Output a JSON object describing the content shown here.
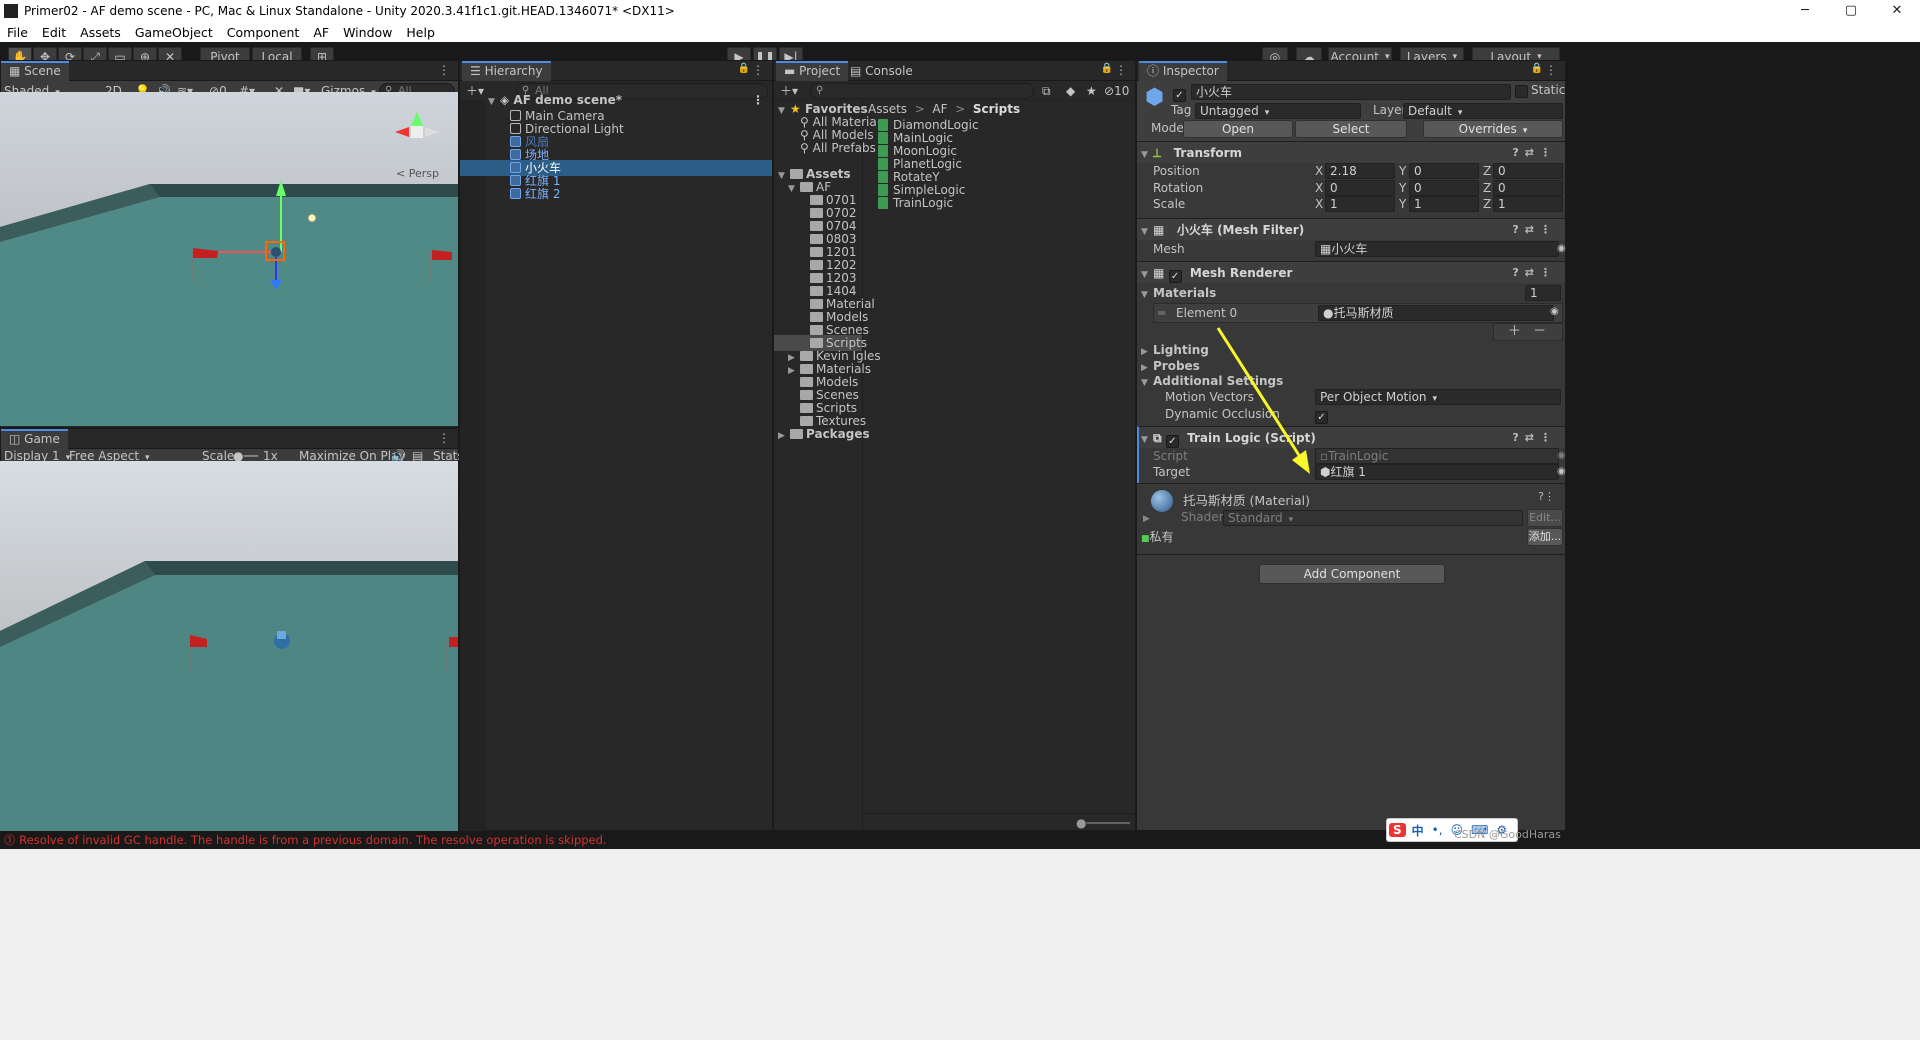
{
  "window": {
    "title": "Primer02 - AF demo scene - PC, Mac & Linux Standalone - Unity 2020.3.41f1c1.git.HEAD.1346071* <DX11>",
    "controls": [
      "─",
      "▢",
      "✕"
    ]
  },
  "menu": [
    "File",
    "Edit",
    "Assets",
    "GameObject",
    "Component",
    "AF",
    "Window",
    "Help"
  ],
  "toolbar": {
    "pivot": "Pivot",
    "local": "Local",
    "account": "Account",
    "layers": "Layers",
    "layout": "Layout"
  },
  "scene": {
    "tab": "Scene",
    "shading": "Shaded",
    "mode2d": "2D",
    "hidden_count": "0",
    "gizmos": "Gizmos",
    "search_placeholder": "All",
    "persp": "< Persp"
  },
  "game": {
    "tab": "Game",
    "display": "Display 1",
    "aspect": "Free Aspect",
    "scale_label": "Scale",
    "scale_value": "1x",
    "maximize": "Maximize On Play",
    "stats": "Stats"
  },
  "hierarchy": {
    "tab": "Hierarchy",
    "search_placeholder": "All",
    "scene_name": "AF demo scene*",
    "items": [
      {
        "label": "Main Camera",
        "style": "normal"
      },
      {
        "label": "Directional Light",
        "style": "normal"
      },
      {
        "label": "风扇",
        "style": "dark"
      },
      {
        "label": "场地",
        "style": "prefab"
      },
      {
        "label": "小火车",
        "style": "selected"
      },
      {
        "label": "红旗 1",
        "style": "prefab"
      },
      {
        "label": "红旗 2",
        "style": "prefab"
      }
    ]
  },
  "project": {
    "tab": "Project",
    "console_tab": "Console",
    "hidden_count": "10",
    "favorites_label": "Favorites",
    "favorites": [
      "All Materia",
      "All Models",
      "All Prefabs"
    ],
    "assets_label": "Assets",
    "af_label": "AF",
    "af_children": [
      "0701",
      "0702",
      "0704",
      "0803",
      "1201",
      "1202",
      "1203",
      "1404",
      "Material",
      "Models",
      "Scenes",
      "Scripts"
    ],
    "asset_children": [
      "Kevin Igles",
      "Materials",
      "Models",
      "Scenes",
      "Scripts",
      "Textures"
    ],
    "packages_label": "Packages",
    "breadcrumb": [
      "Assets",
      "AF",
      "Scripts"
    ],
    "files": [
      "DiamondLogic",
      "MainLogic",
      "MoonLogic",
      "PlanetLogic",
      "RotateY",
      "SimpleLogic",
      "TrainLogic"
    ]
  },
  "inspector": {
    "tab": "Inspector",
    "object_name": "小火车",
    "static_label": "Static",
    "tag_label": "Tag",
    "tag_value": "Untagged",
    "layer_label": "Layer",
    "layer_value": "Default",
    "model_label": "Model",
    "model_open": "Open",
    "model_select": "Select",
    "model_overrides": "Overrides",
    "transform": {
      "title": "Transform",
      "rows": [
        {
          "label": "Position",
          "x": "2.18",
          "y": "0",
          "z": "0"
        },
        {
          "label": "Rotation",
          "x": "0",
          "y": "0",
          "z": "0"
        },
        {
          "label": "Scale",
          "x": "1",
          "y": "1",
          "z": "1"
        }
      ]
    },
    "mesh_filter": {
      "title": "小火车 (Mesh Filter)",
      "mesh_label": "Mesh",
      "mesh_value": "小火车"
    },
    "mesh_renderer": {
      "title": "Mesh Renderer",
      "materials_label": "Materials",
      "materials_count": "1",
      "element_label": "Element 0",
      "element_value": "托马斯材质",
      "lighting": "Lighting",
      "probes": "Probes",
      "additional": "Additional Settings",
      "motion_label": "Motion Vectors",
      "motion_value": "Per Object Motion",
      "occlusion_label": "Dynamic Occlusion"
    },
    "train_logic": {
      "title": "Train Logic (Script)",
      "script_label": "Script",
      "script_value": "TrainLogic",
      "target_label": "Target",
      "target_value": "红旗 1"
    },
    "material": {
      "name": "托马斯材质 (Material)",
      "shader_label": "Shader",
      "shader_value": "Standard",
      "edit": "Edit...",
      "private_label": "私有",
      "add": "添加..."
    },
    "add_component": "Add Component"
  },
  "status": {
    "message": "Resolve of invalid GC handle. The handle is from a previous domain. The resolve operation is skipped."
  },
  "ime": {
    "lang": "中",
    "watermark": "CSDN @GoodHaras"
  },
  "colors": {
    "selection": "#2c5d87",
    "accent": "#4d8ae1",
    "arrow": "#f7f72a",
    "error": "#d23232"
  }
}
